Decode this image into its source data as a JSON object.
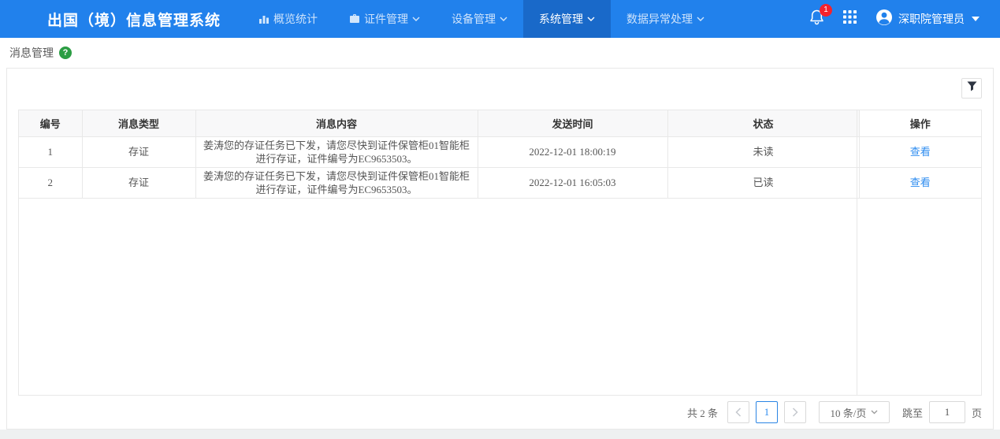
{
  "header": {
    "title": "出国（境）信息管理系统",
    "nav": [
      {
        "label": "概览统计",
        "icon": "bar-chart-icon",
        "active": false
      },
      {
        "label": "证件管理",
        "icon": "briefcase-icon",
        "active": false
      },
      {
        "label": "设备管理",
        "icon": null,
        "active": false
      },
      {
        "label": "系统管理",
        "icon": null,
        "active": true
      },
      {
        "label": "数据异常处理",
        "icon": null,
        "active": false
      }
    ],
    "notification_count": "1",
    "username": "深职院管理员"
  },
  "breadcrumb": {
    "title": "消息管理",
    "help_icon": "question-mark"
  },
  "table": {
    "columns": [
      "编号",
      "消息类型",
      "消息内容",
      "发送时间",
      "状态",
      "操作"
    ],
    "rows": [
      {
        "id": "1",
        "type": "存证",
        "content": "姜涛您的存证任务已下发，请您尽快到证件保管柜01智能柜进行存证，证件编号为EC9653503。",
        "time": "2022-12-01 18:00:19",
        "status": "未读",
        "action": "查看"
      },
      {
        "id": "2",
        "type": "存证",
        "content": "姜涛您的存证任务已下发，请您尽快到证件保管柜01智能柜进行存证，证件编号为EC9653503。",
        "time": "2022-12-01 16:05:03",
        "status": "已读",
        "action": "查看"
      }
    ]
  },
  "pagination": {
    "total_text": "共 2 条",
    "current_page": "1",
    "page_size": "10 条/页",
    "jump_label": "跳至",
    "jump_value": "1",
    "jump_suffix": "页"
  },
  "colors": {
    "header_bg": "#2181ec",
    "header_active_bg": "#1969c9",
    "badge_red": "#f5222d",
    "help_green": "#2b9d43",
    "link_blue": "#2d8cf0",
    "table_border": "#e8e8e8",
    "header_row_bg": "#f8f8f9"
  }
}
